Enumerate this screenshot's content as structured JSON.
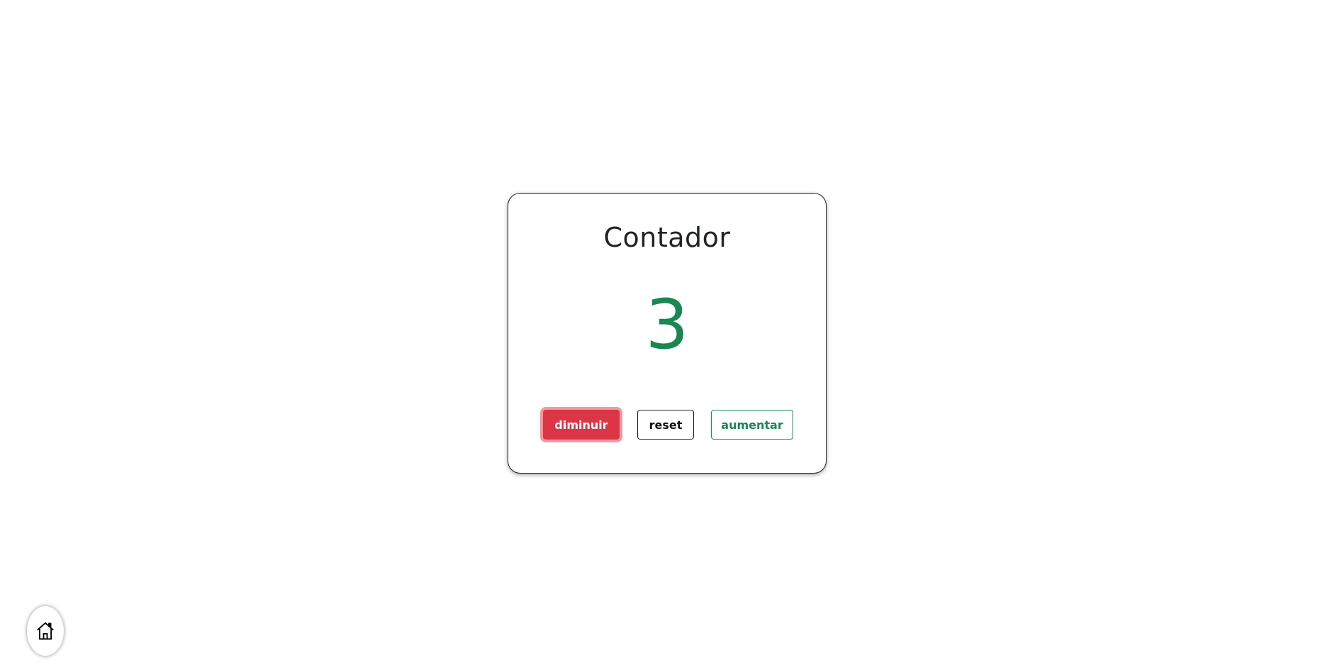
{
  "counter": {
    "title": "Contador",
    "value": "3",
    "value_color": "#198754"
  },
  "buttons": {
    "decrease_label": "diminuir",
    "reset_label": "reset",
    "increase_label": "aumentar"
  },
  "colors": {
    "danger": "#dc3545",
    "success": "#198754",
    "text": "#212529"
  },
  "home": {
    "icon": "home-icon"
  }
}
